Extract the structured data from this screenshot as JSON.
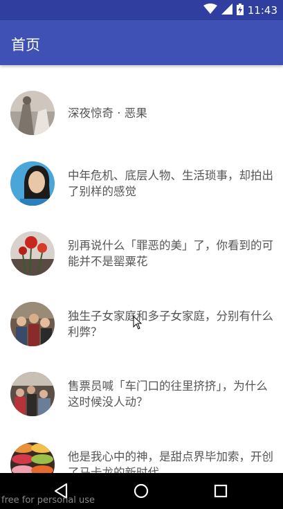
{
  "status_bar": {
    "time": "11:43"
  },
  "app_bar": {
    "title": "首页"
  },
  "list": {
    "items": [
      {
        "title": "深夜惊奇 · 恶果",
        "thumbnail": "foggy-figures-photo"
      },
      {
        "title": "中年危机、底层人物、生活琐事，却拍出了别样的感觉",
        "thumbnail": "woman-portrait-photo"
      },
      {
        "title": "别再说什么「罪恶的美」了，你看到的可能并不是罂粟花",
        "thumbnail": "red-poppy-photo"
      },
      {
        "title": "独生子女家庭和多子女家庭，分别有什么利弊？",
        "thumbnail": "family-group-photo"
      },
      {
        "title": "售票员喊「车门口的往里挤挤」，为什么这时候没人动？",
        "thumbnail": "crowded-bus-photo"
      },
      {
        "title": "他是我心中的神，是甜点界毕加索，开创了马卡龙的新时代",
        "thumbnail": "macarons-photo"
      }
    ]
  },
  "watermark": "free for personal use",
  "colors": {
    "status_bar": "#303f9f",
    "app_bar": "#3f51b5",
    "nav_bar": "#000000",
    "item_text": "#555555"
  }
}
